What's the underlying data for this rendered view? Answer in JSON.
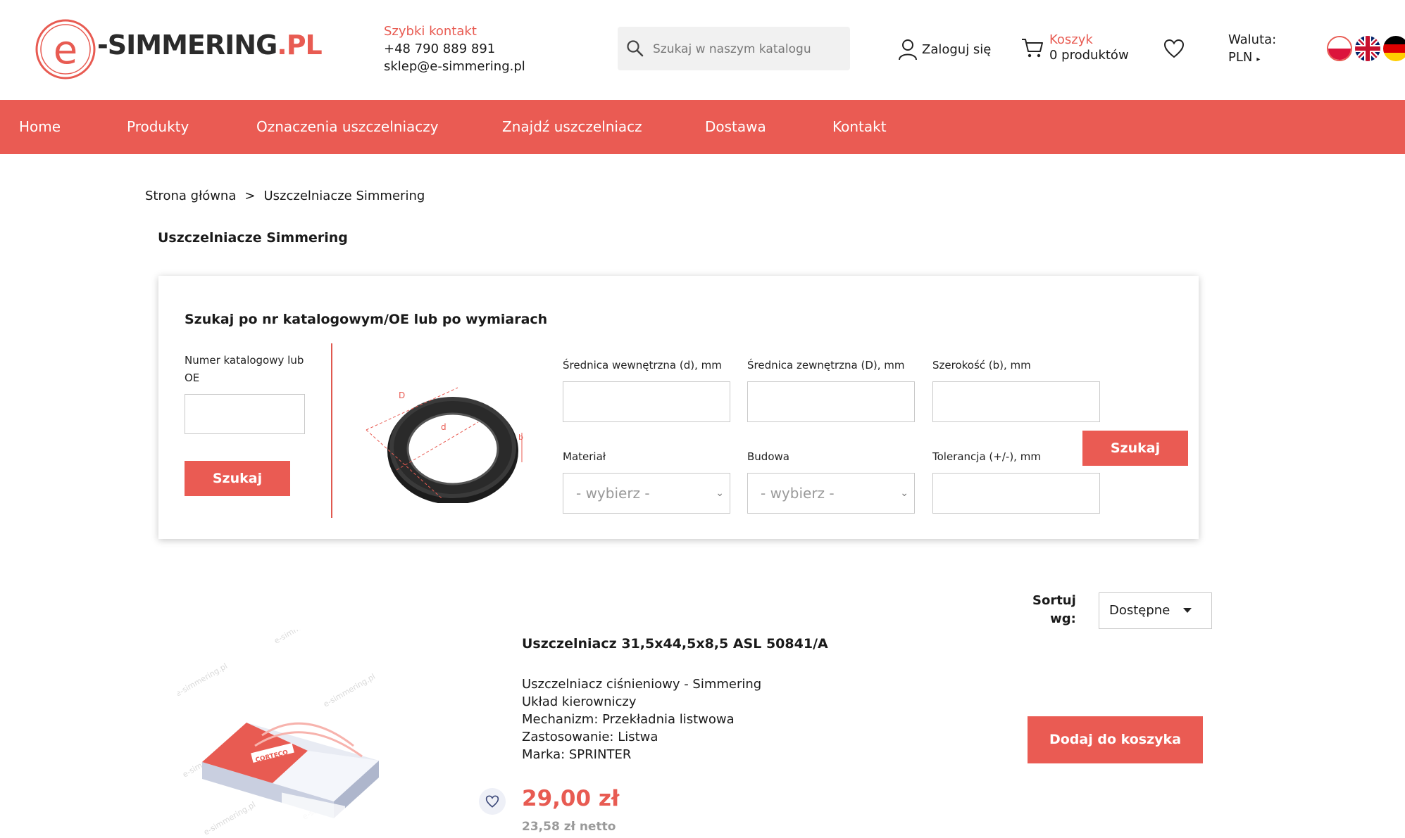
{
  "header": {
    "logo": {
      "text_main": "-SIMMERING",
      "text_suffix": ".PL"
    },
    "contact": {
      "title": "Szybki kontakt",
      "phone": "+48 790 889 891",
      "email": "sklep@e-simmering.pl"
    },
    "search": {
      "placeholder": "Szukaj w naszym katalogu",
      "icon": "search-icon"
    },
    "login_label": "Zaloguj się",
    "cart": {
      "title": "Koszyk",
      "count_label": "0 produktów"
    },
    "currency": {
      "label": "Waluta:",
      "value": "PLN"
    },
    "languages": [
      "pl-flag-icon",
      "uk-flag-icon",
      "de-flag-icon"
    ]
  },
  "nav": {
    "items": [
      {
        "label": "Home"
      },
      {
        "label": "Produkty"
      },
      {
        "label": "Oznaczenia uszczelniaczy"
      },
      {
        "label": "Znajdź uszczelniacz"
      },
      {
        "label": "Dostawa"
      },
      {
        "label": "Kontakt"
      }
    ]
  },
  "breadcrumb": {
    "home": "Strona główna",
    "separator": ">",
    "current": "Uszczelniacze Simmering"
  },
  "page_title": "Uszczelniacze Simmering",
  "search_panel": {
    "title": "Szukaj po nr katalogowym/OE lub po wymiarach",
    "catalog": {
      "label_line1": "Numer katalogowy lub",
      "label_line2": "OE",
      "value": "",
      "button": "Szukaj"
    },
    "diagram_labels": {
      "outer": "D",
      "inner": "d",
      "width": "b"
    },
    "fields": {
      "inner_diameter": {
        "label": "Średnica wewnętrzna (d), mm",
        "value": ""
      },
      "outer_diameter": {
        "label": "Średnica zewnętrzna (D), mm",
        "value": ""
      },
      "width": {
        "label": "Szerokość (b), mm",
        "value": ""
      },
      "material": {
        "label": "Materiał",
        "selected": "- wybierz -"
      },
      "construction": {
        "label": "Budowa",
        "selected": "- wybierz -"
      },
      "tolerance": {
        "label": "Tolerancja (+/-), mm",
        "value": ""
      }
    },
    "search_button": "Szukaj"
  },
  "sort": {
    "label_line1": "Sortuj",
    "label_line2": "wg:",
    "selected": "Dostępne"
  },
  "product": {
    "title": "Uszczelniacz 31,5x44,5x8,5 ASL 50841/A",
    "description": [
      "Uszczelniacz ciśnieniowy - Simmering",
      "Układ kierowniczy",
      "Mechanizm: Przekładnia listwowa",
      "Zastosowanie: Listwa",
      "Marka: SPRINTER"
    ],
    "price": "29,00 zł",
    "price_net": "23,58 zł netto",
    "add_to_cart": "Dodaj do koszyka",
    "box_brand": "CORTECO",
    "watermark": "e-simmering.pl"
  },
  "colors": {
    "accent": "#ea5b53",
    "text": "#1a1a1a",
    "muted": "#9a9a9a"
  }
}
